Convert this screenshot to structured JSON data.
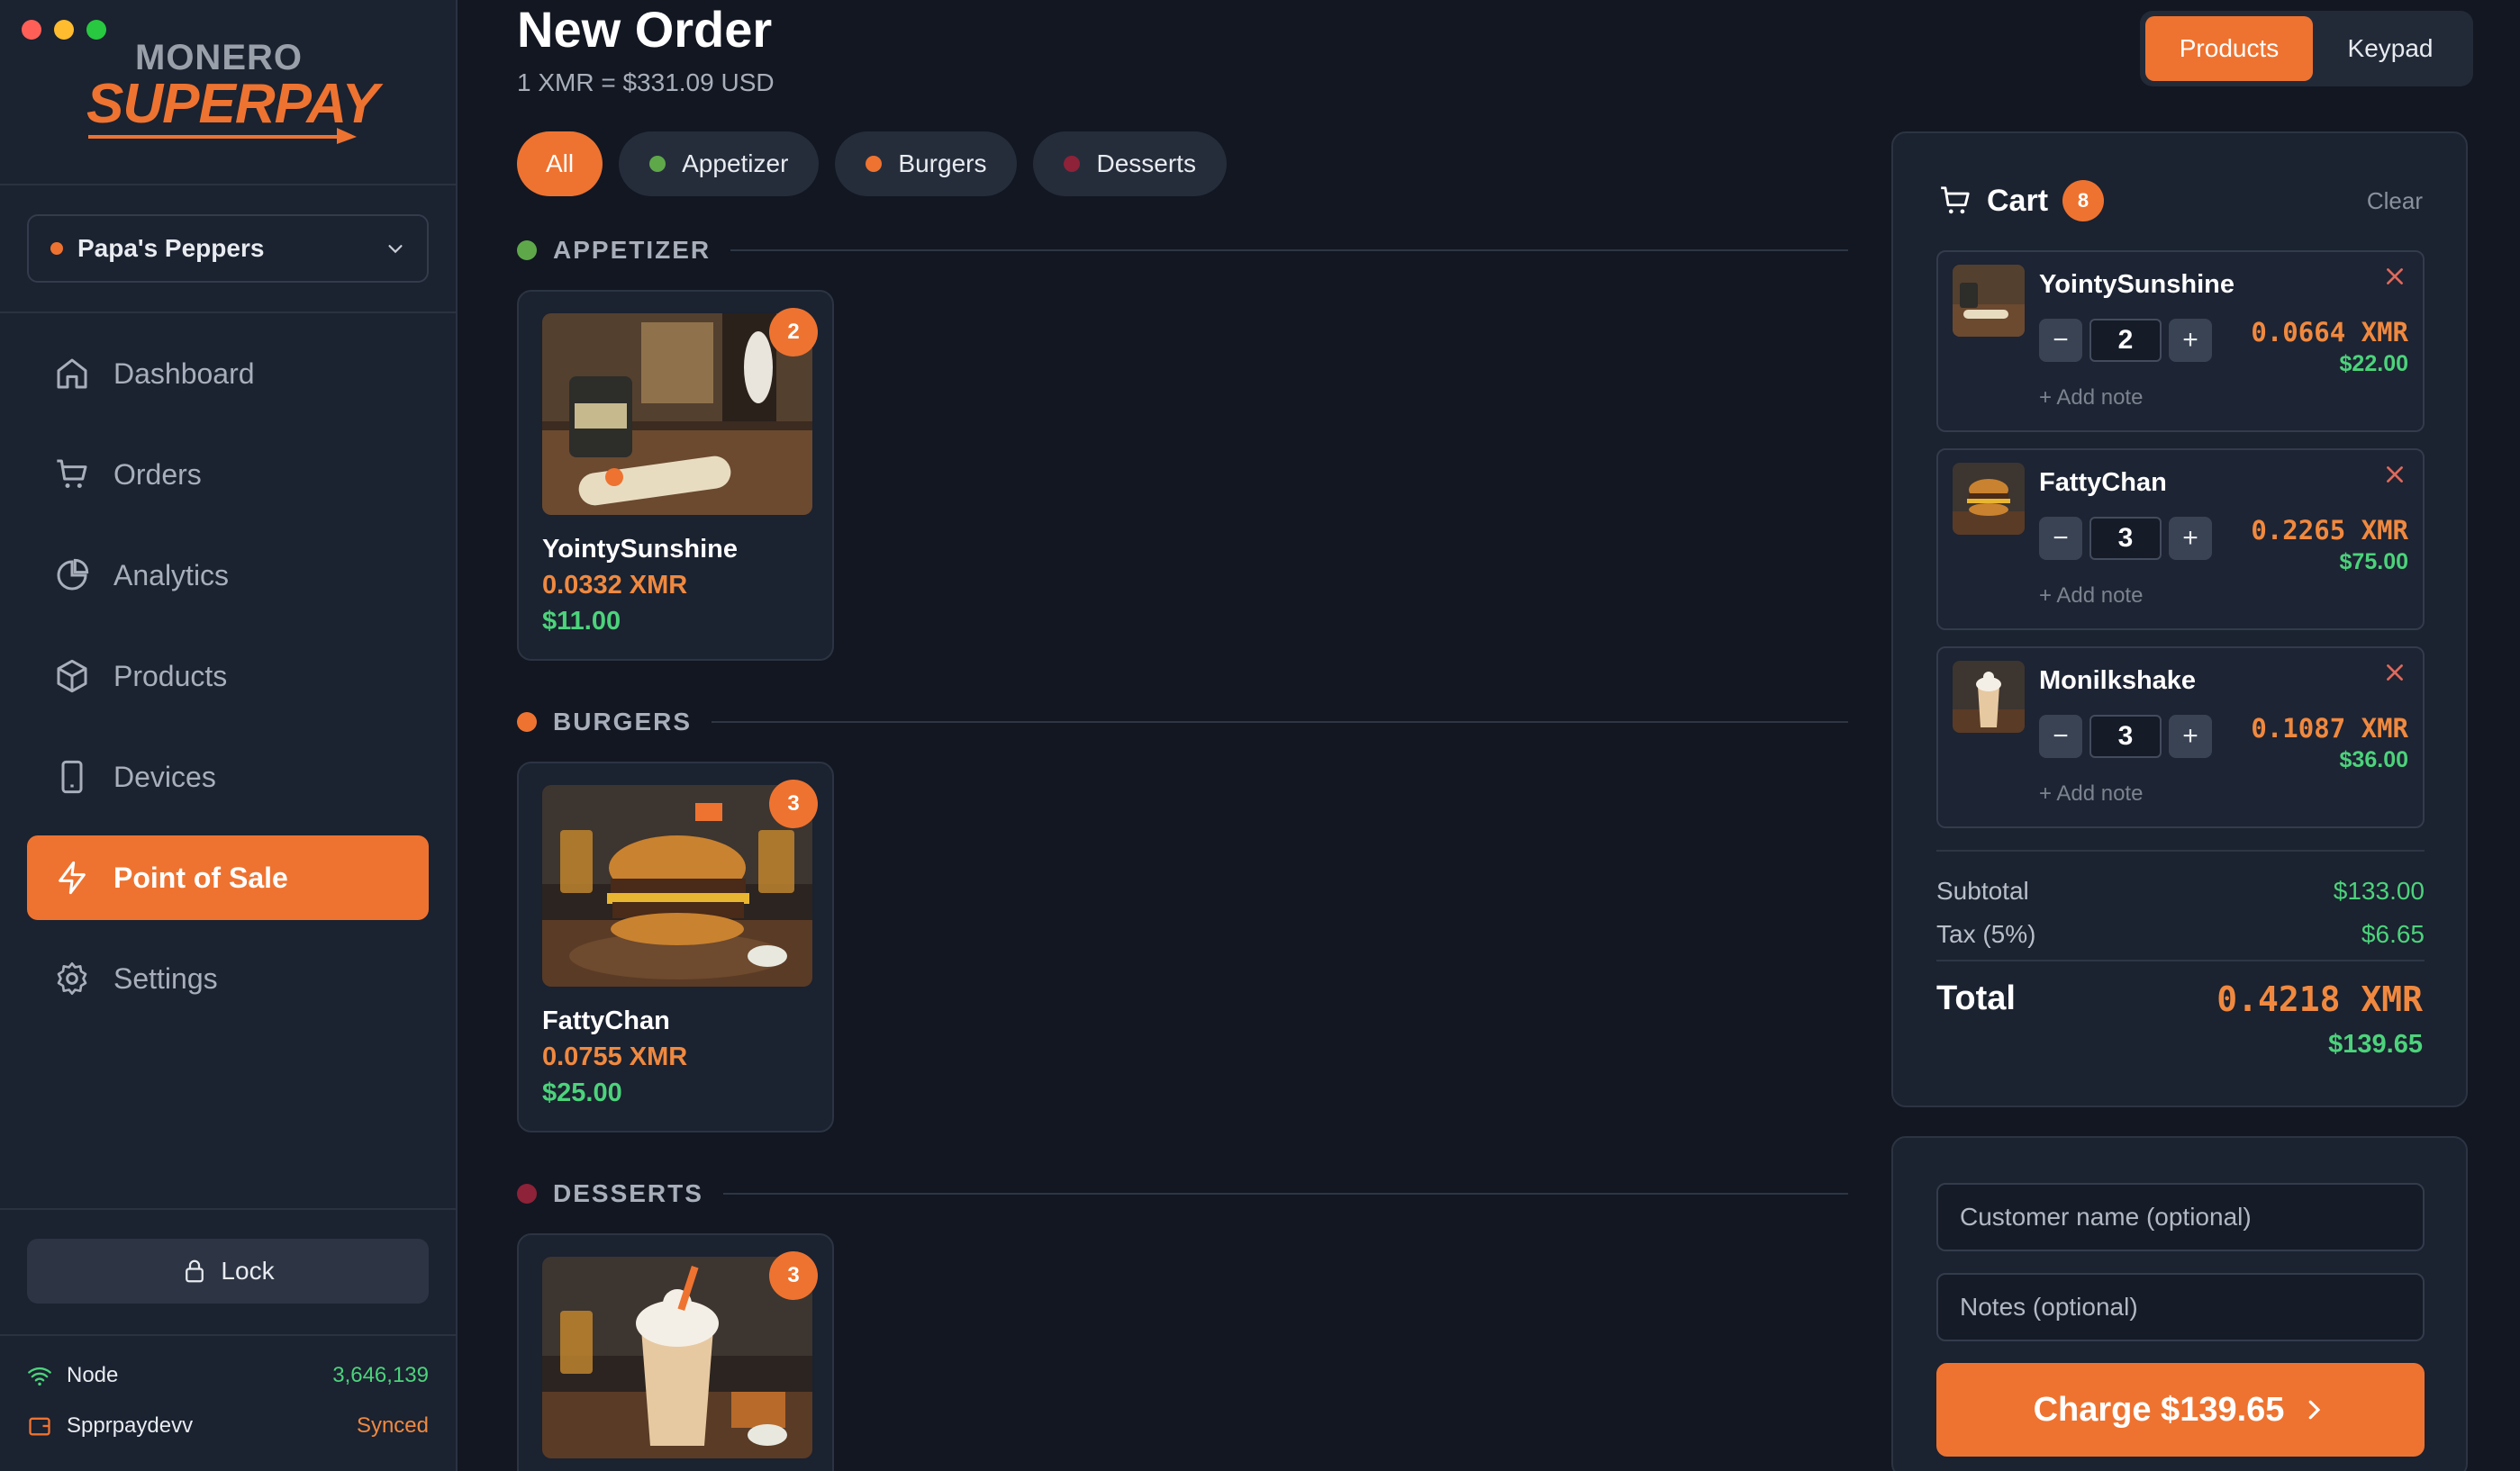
{
  "brand": {
    "line1": "MONERO",
    "line2a": "SUPER",
    "line2b": "PAY"
  },
  "store": {
    "name": "Papa's Peppers"
  },
  "nav": [
    {
      "label": "Dashboard",
      "icon": "home-icon",
      "active": false
    },
    {
      "label": "Orders",
      "icon": "cart-icon",
      "active": false
    },
    {
      "label": "Analytics",
      "icon": "pie-chart-icon",
      "active": false
    },
    {
      "label": "Products",
      "icon": "box-icon",
      "active": false
    },
    {
      "label": "Devices",
      "icon": "tablet-icon",
      "active": false
    },
    {
      "label": "Point of Sale",
      "icon": "bolt-icon",
      "active": true
    },
    {
      "label": "Settings",
      "icon": "gear-icon",
      "active": false
    }
  ],
  "lock": {
    "label": "Lock"
  },
  "status": {
    "node_label": "Node",
    "node_value": "3,646,139",
    "wallet_label": "Spprpaydevv",
    "wallet_value": "Synced"
  },
  "header": {
    "title": "New Order",
    "rate": "1 XMR = $331.09 USD"
  },
  "mode": {
    "products": "Products",
    "keypad": "Keypad"
  },
  "filters": [
    {
      "label": "All",
      "active": true,
      "color": ""
    },
    {
      "label": "Appetizer",
      "active": false,
      "color": "#5fa84a"
    },
    {
      "label": "Burgers",
      "active": false,
      "color": "#ee7330"
    },
    {
      "label": "Desserts",
      "active": false,
      "color": "#8e2238"
    }
  ],
  "sections": [
    {
      "title": "APPETIZER",
      "color": "#5fa84a"
    },
    {
      "title": "BURGERS",
      "color": "#ee7330"
    },
    {
      "title": "DESSERTS",
      "color": "#8e2238"
    }
  ],
  "products": [
    {
      "name": "YointySunshine",
      "xmr": "0.0332 XMR",
      "usd": "$11.00",
      "qty": "2"
    },
    {
      "name": "FattyChan",
      "xmr": "0.0755 XMR",
      "usd": "$25.00",
      "qty": "3"
    },
    {
      "name": "Monilkshake",
      "qty": "3"
    }
  ],
  "cart": {
    "title": "Cart",
    "count": "8",
    "clear": "Clear",
    "items": [
      {
        "name": "YointySunshine",
        "qty": "2",
        "xmr": "0.0664 XMR",
        "usd": "$22.00",
        "note": "+ Add note"
      },
      {
        "name": "FattyChan",
        "qty": "3",
        "xmr": "0.2265 XMR",
        "usd": "$75.00",
        "note": "+ Add note"
      },
      {
        "name": "Monilkshake",
        "qty": "3",
        "xmr": "0.1087 XMR",
        "usd": "$36.00",
        "note": "+ Add note"
      }
    ],
    "subtotal_label": "Subtotal",
    "subtotal": "$133.00",
    "tax_label": "Tax (5%)",
    "tax": "$6.65",
    "total_label": "Total",
    "total_xmr": "0.4218 XMR",
    "total_usd": "$139.65"
  },
  "checkout": {
    "customer_placeholder": "Customer name (optional)",
    "notes_placeholder": "Notes (optional)",
    "charge_label": "Charge $139.65"
  },
  "colors": {
    "accent": "#ee7330",
    "xmr": "#f0893f",
    "usd": "#4cd37b",
    "bg": "#121722",
    "panel": "#1b2230"
  }
}
